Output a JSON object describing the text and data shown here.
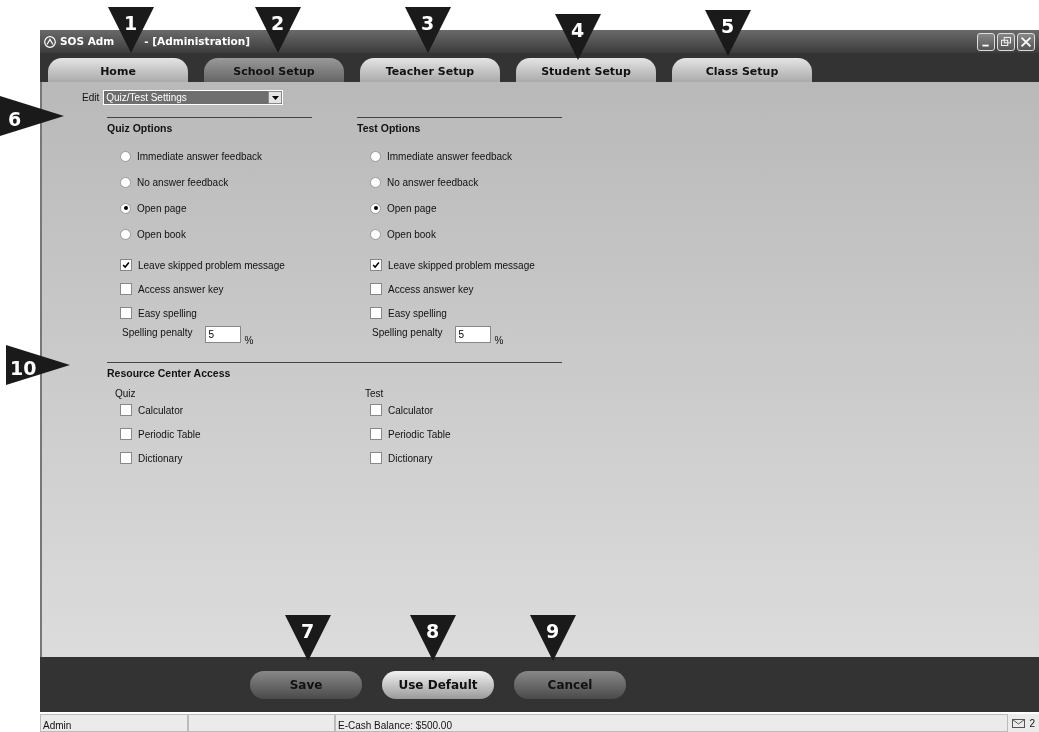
{
  "window": {
    "title_parts": [
      "SOS Adm",
      "- [Administration]"
    ]
  },
  "tabs": [
    {
      "label": "Home",
      "selected": false
    },
    {
      "label": "School Setup",
      "selected": true
    },
    {
      "label": "Teacher Setup",
      "selected": false
    },
    {
      "label": "Student Setup",
      "selected": false
    },
    {
      "label": "Class Setup",
      "selected": false
    }
  ],
  "edit": {
    "label": "Edit",
    "value": "Quiz/Test Settings"
  },
  "option_panels": [
    {
      "title": "Quiz Options",
      "radios": [
        {
          "label": "Immediate answer feedback",
          "selected": false
        },
        {
          "label": "No answer feedback",
          "selected": false
        },
        {
          "label": "Open page",
          "selected": true
        },
        {
          "label": "Open book",
          "selected": false
        }
      ],
      "checkboxes": [
        {
          "label": "Leave skipped problem message",
          "checked": true
        },
        {
          "label": "Access answer key",
          "checked": false
        },
        {
          "label": "Easy spelling",
          "checked": false
        }
      ],
      "penalty": {
        "label": "Spelling penalty",
        "value": "5",
        "unit": "%"
      }
    },
    {
      "title": "Test Options",
      "radios": [
        {
          "label": "Immediate answer feedback",
          "selected": false
        },
        {
          "label": "No answer feedback",
          "selected": false
        },
        {
          "label": "Open page",
          "selected": true
        },
        {
          "label": "Open book",
          "selected": false
        }
      ],
      "checkboxes": [
        {
          "label": "Leave skipped problem message",
          "checked": true
        },
        {
          "label": "Access answer key",
          "checked": false
        },
        {
          "label": "Easy spelling",
          "checked": false
        }
      ],
      "penalty": {
        "label": "Spelling penalty",
        "value": "5",
        "unit": "%"
      }
    }
  ],
  "resource_center": {
    "title": "Resource Center Access",
    "groups": [
      {
        "label": "Quiz",
        "items": [
          {
            "label": "Calculator",
            "checked": false
          },
          {
            "label": "Periodic Table",
            "checked": false
          },
          {
            "label": "Dictionary",
            "checked": false
          }
        ]
      },
      {
        "label": "Test",
        "items": [
          {
            "label": "Calculator",
            "checked": false
          },
          {
            "label": "Periodic Table",
            "checked": false
          },
          {
            "label": "Dictionary",
            "checked": false
          }
        ]
      }
    ]
  },
  "buttons": [
    {
      "label": "Save",
      "highlighted": false
    },
    {
      "label": "Use Default",
      "highlighted": true
    },
    {
      "label": "Cancel",
      "highlighted": false
    }
  ],
  "status_bar": {
    "user": "Admin",
    "balance": "E-Cash Balance: $500.00",
    "messages": "2"
  },
  "callouts": [
    {
      "label": "1",
      "kind": "down"
    },
    {
      "label": "2",
      "kind": "down"
    },
    {
      "label": "3",
      "kind": "down"
    },
    {
      "label": "4",
      "kind": "down"
    },
    {
      "label": "5",
      "kind": "down"
    },
    {
      "label": "6",
      "kind": "right"
    },
    {
      "label": "7",
      "kind": "down"
    },
    {
      "label": "8",
      "kind": "down"
    },
    {
      "label": "9",
      "kind": "down"
    },
    {
      "label": "10",
      "kind": "right"
    }
  ]
}
